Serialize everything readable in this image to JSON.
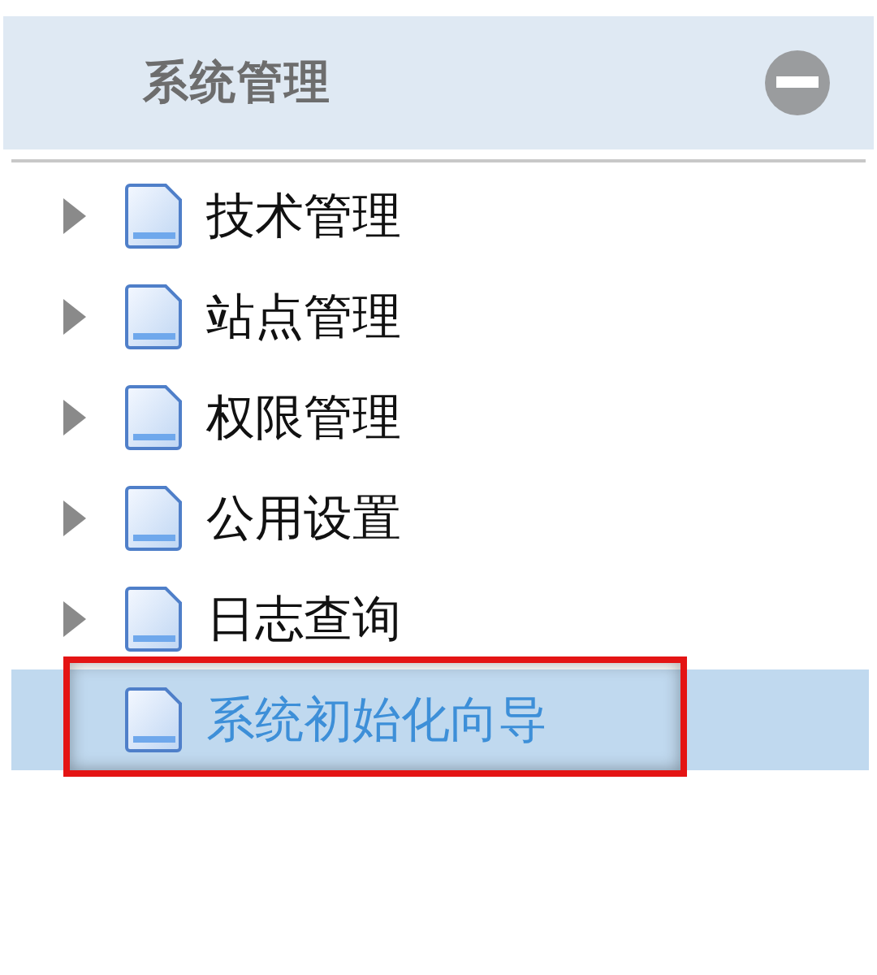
{
  "panel": {
    "title": "系统管理",
    "expanded": true
  },
  "items": [
    {
      "label": "技术管理",
      "kind": "branch",
      "selected": false,
      "outlined": false
    },
    {
      "label": "站点管理",
      "kind": "branch",
      "selected": false,
      "outlined": false
    },
    {
      "label": "权限管理",
      "kind": "branch",
      "selected": false,
      "outlined": false
    },
    {
      "label": "公用设置",
      "kind": "branch",
      "selected": false,
      "outlined": false
    },
    {
      "label": "日志查询",
      "kind": "branch",
      "selected": false,
      "outlined": false
    },
    {
      "label": "系统初始化向导",
      "kind": "leaf",
      "selected": true,
      "outlined": true
    }
  ]
}
